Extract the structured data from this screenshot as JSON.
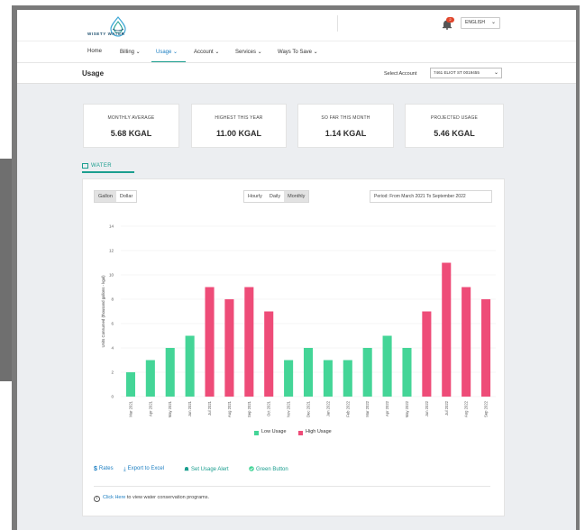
{
  "brand": {
    "name": "WISETY WATER"
  },
  "header": {
    "notification_count": "2",
    "language": "ENGLISH"
  },
  "nav": {
    "items": [
      {
        "label": "Home"
      },
      {
        "label": "Billing"
      },
      {
        "label": "Usage"
      },
      {
        "label": "Account"
      },
      {
        "label": "Services"
      },
      {
        "label": "Ways To Save"
      }
    ],
    "active": "Usage"
  },
  "subheader": {
    "title": "Usage",
    "account_label": "Select Account",
    "account_value": "7461 ELIOT ST 0019455"
  },
  "stats": [
    {
      "label": "MONTHLY AVERAGE",
      "value": "5.68 KGAL"
    },
    {
      "label": "HIGHEST THIS YEAR",
      "value": "11.00 KGAL"
    },
    {
      "label": "SO FAR THIS MONTH",
      "value": "1.14 KGAL"
    },
    {
      "label": "PROJECTED USAGE",
      "value": "5.46 KGAL"
    }
  ],
  "tab": {
    "label": "WATER"
  },
  "controls": {
    "unit_toggle": [
      {
        "label": "Gallon",
        "selected": true
      },
      {
        "label": "Dollar",
        "selected": false
      }
    ],
    "interval_toggle": [
      {
        "label": "Hourly",
        "selected": false
      },
      {
        "label": "Daily",
        "selected": false
      },
      {
        "label": "Monthly",
        "selected": true
      }
    ],
    "period": "Period: From March 2021 To September 2022"
  },
  "colors": {
    "low": "#44d597",
    "high": "#ee4c78",
    "accent": "#1b9e8f",
    "link": "#1b7ec2"
  },
  "chart_data": {
    "type": "bar",
    "ylabel": "Units Consumed (thousand gallons - kgal)",
    "ylim": [
      0,
      14
    ],
    "yticks": [
      0,
      2,
      4,
      6,
      8,
      10,
      12,
      14
    ],
    "grid": true,
    "legend_position": "bottom-center",
    "categories": [
      "Mar 2021",
      "Apr 2021",
      "May 2021",
      "Jun 2021",
      "Jul 2021",
      "Aug 2021",
      "Sep 2021",
      "Oct 2021",
      "Nov 2021",
      "Dec 2021",
      "Jan 2022",
      "Feb 2022",
      "Mar 2022",
      "Apr 2022",
      "May 2022",
      "Jun 2022",
      "Jul 2022",
      "Aug 2022",
      "Sep 2022"
    ],
    "values": [
      2,
      3,
      4,
      5,
      9,
      8,
      9,
      7,
      3,
      4,
      3,
      3,
      4,
      5,
      4,
      7,
      11,
      9,
      8
    ],
    "usage_level": [
      "Low Usage",
      "Low Usage",
      "Low Usage",
      "Low Usage",
      "High Usage",
      "High Usage",
      "High Usage",
      "High Usage",
      "Low Usage",
      "Low Usage",
      "Low Usage",
      "Low Usage",
      "Low Usage",
      "Low Usage",
      "Low Usage",
      "High Usage",
      "High Usage",
      "High Usage",
      "High Usage"
    ],
    "series": [
      {
        "name": "Low Usage"
      },
      {
        "name": "High Usage"
      }
    ]
  },
  "actions": [
    {
      "label": "Rates",
      "icon": "dollar-icon"
    },
    {
      "label": "Export to Excel",
      "icon": "download-icon"
    },
    {
      "label": "Set Usage Alert",
      "icon": "bell-icon"
    },
    {
      "label": "Green Button",
      "icon": "leaf-icon"
    }
  ],
  "footer_note": {
    "link": "Click Here",
    "text": " to view water conservation programs."
  }
}
